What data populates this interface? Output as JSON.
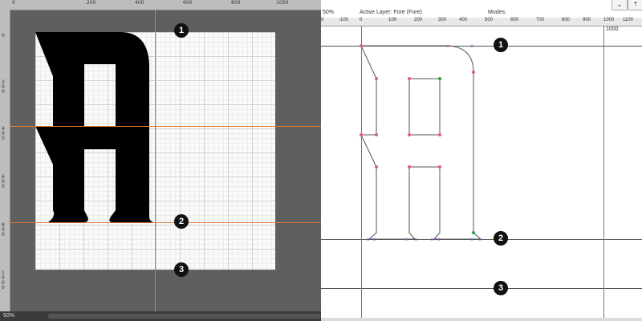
{
  "left_panel": {
    "ruler_top": [
      "0",
      "200",
      "400",
      "600",
      "800",
      "1000"
    ],
    "ruler_left": [
      "0",
      "200",
      "400",
      "600",
      "800",
      "1000"
    ],
    "zoom": "50%"
  },
  "right_panel": {
    "zoom": "50%",
    "active_layer": "Active Layer: Fore (Fore)",
    "modes_label": "Modes:",
    "ruler_top": [
      "0",
      "-100",
      "0",
      "100",
      "200",
      "300",
      "400",
      "500",
      "600",
      "700",
      "800",
      "900",
      "1000",
      "1100"
    ],
    "advance_label": "1000",
    "buttons": {
      "dropdown": "⌄",
      "pin": "⇡"
    }
  },
  "markers": [
    "1",
    "2",
    "3"
  ],
  "icons": {
    "marker": "numbered-circle-icon",
    "dropdown": "chevron-down-icon",
    "pin": "pin-icon"
  },
  "colors": {
    "guide": "#e07b2e",
    "glyph_fill": "#000000",
    "point_pink": "#e05a84",
    "point_violet": "#9a48d6",
    "point_green": "#2f9f4a"
  }
}
